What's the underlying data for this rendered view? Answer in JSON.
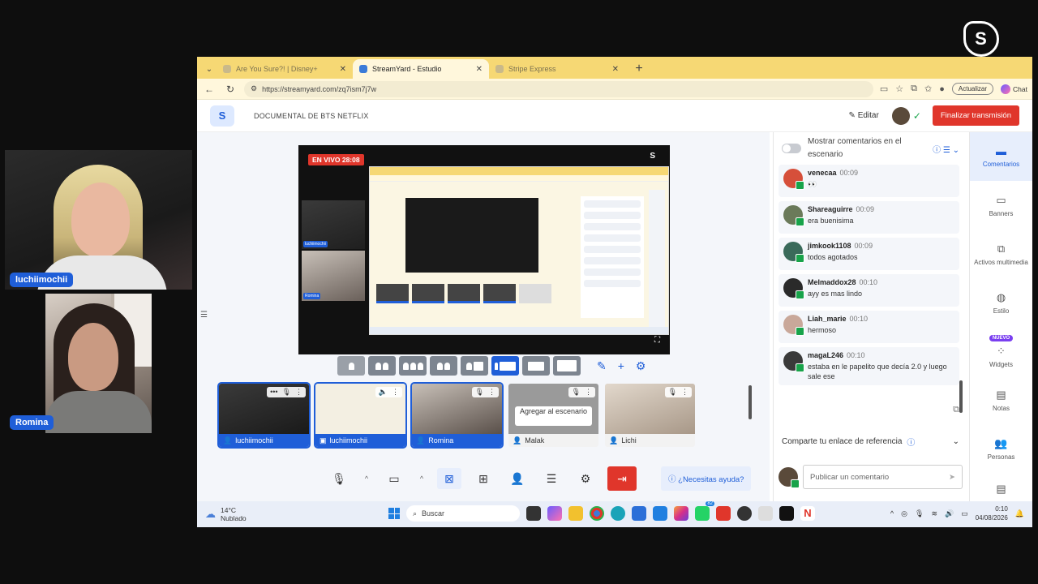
{
  "overlay": {
    "cams": [
      {
        "name": "luchiimochii"
      },
      {
        "name": "Romina"
      }
    ],
    "brand": "streamyard"
  },
  "browser": {
    "tabs": [
      {
        "title": "Are You Sure?! | Disney+"
      },
      {
        "title": "StreamYard - Estudio"
      },
      {
        "title": "Stripe Express"
      }
    ],
    "url": "https://streamyard.com/zq7ism7j7w",
    "update_label": "Actualizar",
    "chat_label": "Chat"
  },
  "app": {
    "broadcast_title": "DOCUMENTAL DE BTS NETFLIX",
    "edit_label": "Editar",
    "finish_label": "Finalizar transmisión"
  },
  "stage": {
    "live_label": "EN VIVO 28:08"
  },
  "participants": [
    {
      "name": "luchiimochii",
      "on_stage": true,
      "type": "camera"
    },
    {
      "name": "luchiimochii",
      "on_stage": true,
      "type": "screen"
    },
    {
      "name": "Romina",
      "on_stage": true,
      "type": "camera"
    },
    {
      "name": "Malak",
      "on_stage": false,
      "type": "camera",
      "add_label": "Agregar al escenario"
    },
    {
      "name": "Lichi",
      "on_stage": false,
      "type": "camera"
    }
  ],
  "controls": {
    "help_label": "¿Necesitas ayuda?"
  },
  "comments_panel": {
    "toggle_label": "Mostrar comentarios en el escenario",
    "comments": [
      {
        "author": "venecaa",
        "time": "00:09",
        "text": "👀"
      },
      {
        "author": "Shareaguirre",
        "time": "00:09",
        "text": "era buenisima"
      },
      {
        "author": "jimkook1108",
        "time": "00:09",
        "text": "todos agotados"
      },
      {
        "author": "Melmaddox28",
        "time": "00:10",
        "text": "ayy es mas lindo"
      },
      {
        "author": "Liah_marie",
        "time": "00:10",
        "text": "hermoso"
      },
      {
        "author": "magaL246",
        "time": "00:10",
        "text": "estaba en le papelito que decía 2.0 y luego sale ese"
      }
    ],
    "referral_label": "Comparte tu enlace de referencia",
    "compose_placeholder": "Publicar un comentario"
  },
  "rail": {
    "items": [
      {
        "label": "Comentarios",
        "icon": "comment-icon"
      },
      {
        "label": "Banners",
        "icon": "banner-icon"
      },
      {
        "label": "Activos multimedia",
        "icon": "media-icon"
      },
      {
        "label": "Estilo",
        "icon": "palette-icon"
      },
      {
        "label": "Widgets",
        "icon": "widgets-icon",
        "badge": "NUEVO"
      },
      {
        "label": "Notas",
        "icon": "notes-icon"
      },
      {
        "label": "Personas",
        "icon": "people-icon"
      }
    ]
  },
  "taskbar": {
    "temp": "14°C",
    "weather": "Nublado",
    "search_label": "Buscar",
    "whatsapp_badge": "82",
    "time": "0:10",
    "date": "04/08/2026"
  },
  "colors": {
    "accent": "#1f5ed8",
    "danger": "#e0362b",
    "tabbar": "#f6d874"
  }
}
